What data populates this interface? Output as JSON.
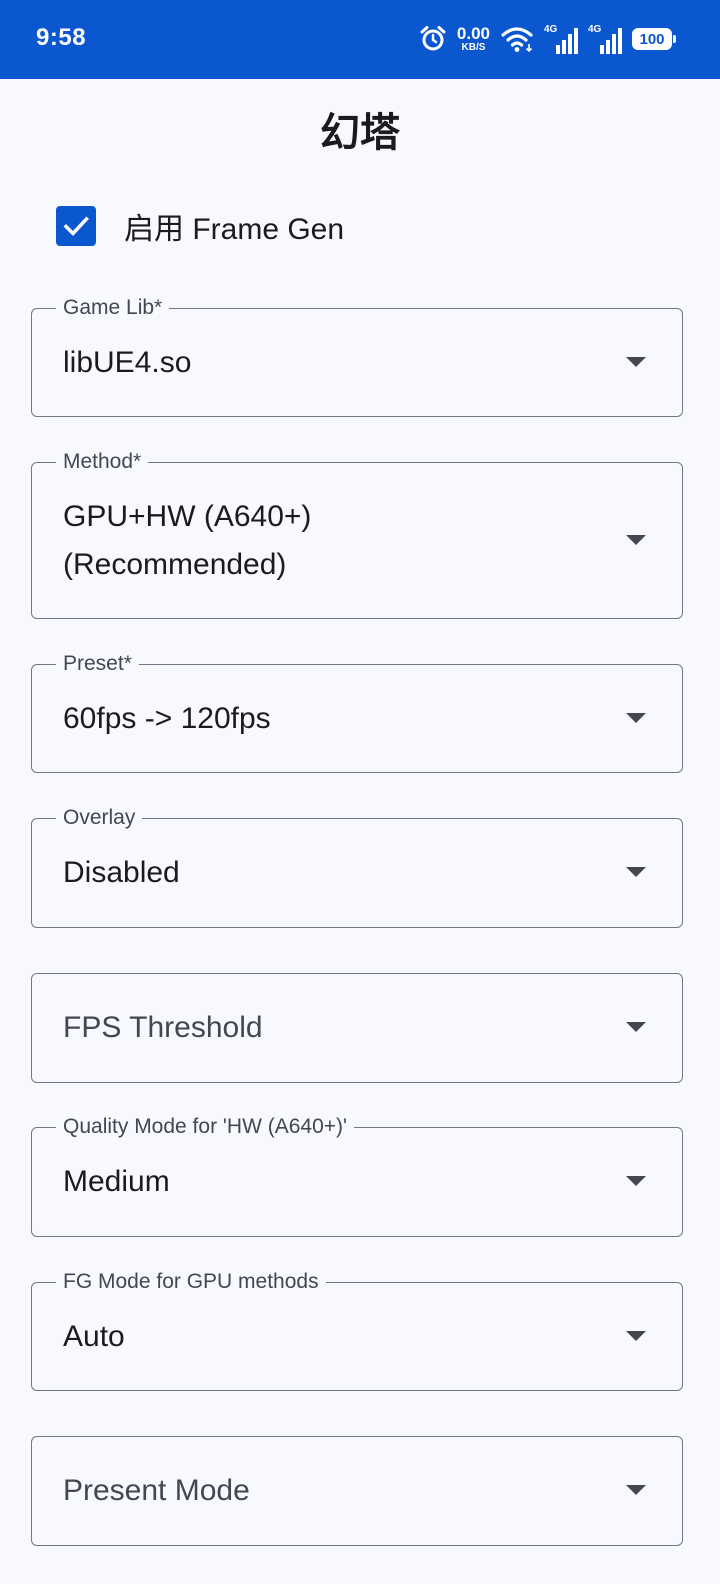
{
  "status_bar": {
    "time": "9:58",
    "net_speed_value": "0.00",
    "net_speed_unit": "KB/S",
    "signal1_tag": "4G",
    "signal2_tag": "4G",
    "battery": "100",
    "icons": [
      "alarm-icon",
      "wifi-icon",
      "signal-icon",
      "signal-icon",
      "battery-icon"
    ]
  },
  "page": {
    "title": "幻塔"
  },
  "frame_gen": {
    "label": "启用 Frame Gen",
    "checked": true
  },
  "fields": {
    "game_lib": {
      "label": "Game Lib*",
      "value": "libUE4.so"
    },
    "method": {
      "label": "Method*",
      "value": "GPU+HW (A640+) (Recommended)"
    },
    "preset": {
      "label": "Preset*",
      "value": "60fps -> 120fps"
    },
    "overlay": {
      "label": "Overlay",
      "value": "Disabled"
    },
    "fps_threshold": {
      "placeholder": "FPS Threshold"
    },
    "quality_mode": {
      "label": "Quality Mode for 'HW (A640+)'",
      "value": "Medium"
    },
    "fg_mode": {
      "label": "FG Mode for GPU methods",
      "value": "Auto"
    },
    "present_mode": {
      "placeholder": "Present Mode"
    }
  },
  "colors": {
    "accent": "#0b57d0",
    "background": "#f8f9fe",
    "outline": "#74777f"
  }
}
